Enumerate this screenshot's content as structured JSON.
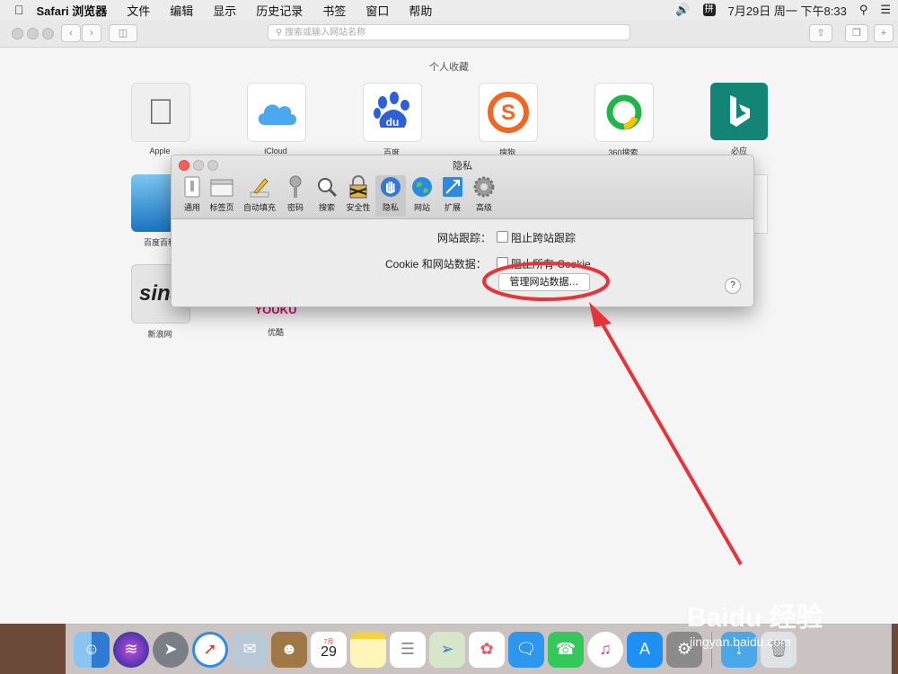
{
  "menubar": {
    "app_name": "Safari 浏览器",
    "items": [
      "文件",
      "编辑",
      "显示",
      "历史记录",
      "书签",
      "窗口",
      "帮助"
    ],
    "input_method": "拼",
    "datetime": "7月29日 周一 下午8:33"
  },
  "toolbar": {
    "url_placeholder": "搜索或输入网站名称"
  },
  "favorites": {
    "title": "个人收藏",
    "row1": [
      {
        "label": "Apple",
        "icon": "apple-icon"
      },
      {
        "label": "iCloud",
        "icon": "cloud-icon"
      },
      {
        "label": "百度",
        "icon": "baidu-paw-icon"
      },
      {
        "label": "搜狗",
        "icon": "sogou-icon"
      },
      {
        "label": "360搜索",
        "icon": "360-icon"
      },
      {
        "label": "必应",
        "icon": "bing-icon"
      }
    ],
    "row2": [
      {
        "label": "百度百科",
        "icon": "baike-icon"
      }
    ],
    "row3": [
      {
        "label": "新浪网",
        "icon": "sina-icon"
      },
      {
        "label": "优酷",
        "icon": "youku-icon",
        "text": "YOUKU"
      }
    ]
  },
  "prefs": {
    "title": "隐私",
    "tabs": [
      "通用",
      "标签页",
      "自动填充",
      "密码",
      "搜索",
      "安全性",
      "隐私",
      "网站",
      "扩展",
      "高级"
    ],
    "active_tab": "隐私",
    "tracking_label": "网站跟踪：",
    "tracking_option": "阻止跨站跟踪",
    "cookie_label": "Cookie 和网站数据：",
    "cookie_option": "阻止所有 Cookie",
    "manage_button": "管理网站数据…",
    "help": "?"
  },
  "annotation": {
    "color": "#e8333a"
  },
  "watermark": {
    "line1": "Baidu 经验",
    "line2": "jingyan.baidu.com"
  },
  "dock": {
    "calendar_month": "7月",
    "calendar_day": "29"
  }
}
